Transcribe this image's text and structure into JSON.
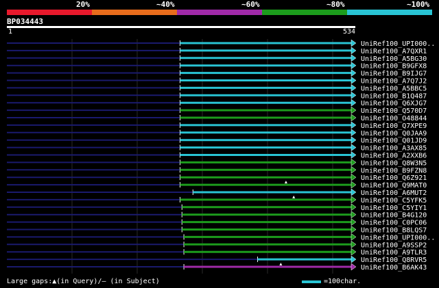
{
  "legend": {
    "segments": [
      {
        "label": "20%",
        "color": "#e8192c"
      },
      {
        "label": "~40%",
        "color": "#e86c1c"
      },
      {
        "label": "~60%",
        "color": "#a02aa8"
      },
      {
        "label": "~80%",
        "color": "#1c9c1c"
      },
      {
        "label": "~100%",
        "color": "#29c4d4"
      }
    ]
  },
  "query": {
    "name": "BP034443",
    "start_label": "1",
    "end_label": "534",
    "length": 534
  },
  "footer": {
    "gaps_text": "Large gaps:▲(in Query)/– (in Subject)",
    "scale_text": "=100char."
  },
  "hits": [
    {
      "label": "UniRef100_UPI000..",
      "start": 268,
      "end": 534,
      "color": "#29c4d4",
      "marker": null
    },
    {
      "label": "UniRef100_A7QXR1",
      "start": 268,
      "end": 534,
      "color": "#29c4d4",
      "marker": null
    },
    {
      "label": "UniRef100_A5BG30",
      "start": 268,
      "end": 534,
      "color": "#29c4d4",
      "marker": null
    },
    {
      "label": "UniRef100_B9GFX8",
      "start": 268,
      "end": 534,
      "color": "#29c4d4",
      "marker": null
    },
    {
      "label": "UniRef100_B9IJG7",
      "start": 268,
      "end": 534,
      "color": "#29c4d4",
      "marker": null
    },
    {
      "label": "UniRef100_A7Q7J2",
      "start": 268,
      "end": 534,
      "color": "#29c4d4",
      "marker": null
    },
    {
      "label": "UniRef100_A5BBC5",
      "start": 268,
      "end": 534,
      "color": "#29c4d4",
      "marker": null
    },
    {
      "label": "UniRef100_B1Q487",
      "start": 268,
      "end": 534,
      "color": "#29c4d4",
      "marker": null
    },
    {
      "label": "UniRef100_Q6XJG7",
      "start": 268,
      "end": 534,
      "color": "#29c4d4",
      "marker": null
    },
    {
      "label": "UniRef100_Q570D7",
      "start": 268,
      "end": 534,
      "color": "#1c9c1c",
      "marker": null
    },
    {
      "label": "UniRef100_O48844",
      "start": 268,
      "end": 534,
      "color": "#1c9c1c",
      "marker": null
    },
    {
      "label": "UniRef100_Q7XPE9",
      "start": 268,
      "end": 534,
      "color": "#29c4d4",
      "marker": null
    },
    {
      "label": "UniRef100_Q0JAA9",
      "start": 268,
      "end": 534,
      "color": "#29c4d4",
      "marker": null
    },
    {
      "label": "UniRef100_Q01JD9",
      "start": 268,
      "end": 534,
      "color": "#29c4d4",
      "marker": null
    },
    {
      "label": "UniRef100_A3AX85",
      "start": 268,
      "end": 534,
      "color": "#29c4d4",
      "marker": null
    },
    {
      "label": "UniRef100_A2XXB6",
      "start": 268,
      "end": 534,
      "color": "#29c4d4",
      "marker": null
    },
    {
      "label": "UniRef100_Q8W3N5",
      "start": 268,
      "end": 534,
      "color": "#1c9c1c",
      "marker": null
    },
    {
      "label": "UniRef100_B9FZN8",
      "start": 268,
      "end": 534,
      "color": "#1c9c1c",
      "marker": null
    },
    {
      "label": "UniRef100_Q6Z921",
      "start": 268,
      "end": 534,
      "color": "#1c9c1c",
      "marker": null
    },
    {
      "label": "UniRef100_Q9MAT0",
      "start": 268,
      "end": 534,
      "color": "#1c9c1c",
      "marker": 432
    },
    {
      "label": "UniRef100_A6MUT2",
      "start": 288,
      "end": 534,
      "color": "#29c4d4",
      "marker": null
    },
    {
      "label": "UniRef100_C5YFK5",
      "start": 268,
      "end": 534,
      "color": "#1c9c1c",
      "marker": 444
    },
    {
      "label": "UniRef100_C5YIY1",
      "start": 271,
      "end": 534,
      "color": "#1c9c1c",
      "marker": null
    },
    {
      "label": "UniRef100_B4G120",
      "start": 271,
      "end": 534,
      "color": "#1c9c1c",
      "marker": null
    },
    {
      "label": "UniRef100_C0PC06",
      "start": 271,
      "end": 534,
      "color": "#1c9c1c",
      "marker": null
    },
    {
      "label": "UniRef100_B8LQS7",
      "start": 271,
      "end": 534,
      "color": "#1c9c1c",
      "marker": null
    },
    {
      "label": "UniRef100_UPI000..",
      "start": 274,
      "end": 534,
      "color": "#1c9c1c",
      "marker": null
    },
    {
      "label": "UniRef100_A9SSP2",
      "start": 274,
      "end": 534,
      "color": "#1c9c1c",
      "marker": null
    },
    {
      "label": "UniRef100_A9TLR3",
      "start": 274,
      "end": 534,
      "color": "#1c9c1c",
      "marker": null
    },
    {
      "label": "UniRef100_Q8RVR5",
      "start": 388,
      "end": 534,
      "color": "#29c4d4",
      "marker": null
    },
    {
      "label": "UniRef100_B6AK43",
      "start": 274,
      "end": 534,
      "color": "#a02aa8",
      "marker": 424
    }
  ]
}
